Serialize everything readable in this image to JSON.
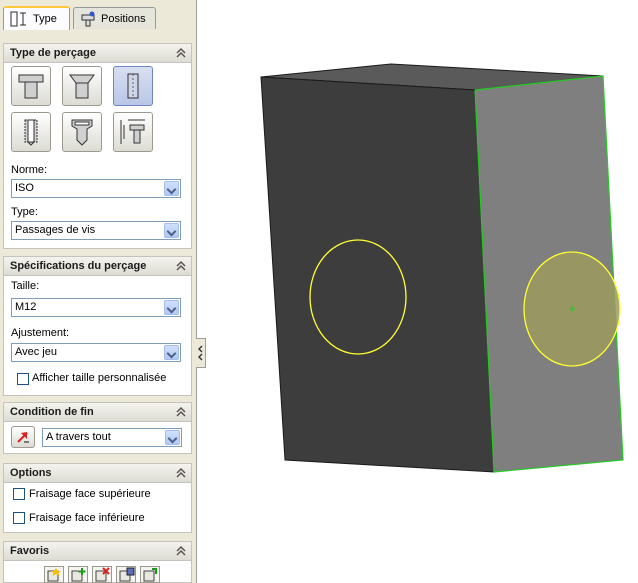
{
  "tabs": [
    {
      "label": "Type",
      "icon": "hole-type-icon",
      "active": true
    },
    {
      "label": "Positions",
      "icon": "hole-position-icon",
      "active": false
    }
  ],
  "hole_type": {
    "title": "Type de perçage",
    "buttons": [
      {
        "icon": "counterbore-icon",
        "selected": false
      },
      {
        "icon": "countersink-icon",
        "selected": false
      },
      {
        "icon": "straight-hole-icon",
        "selected": true
      },
      {
        "icon": "straight-tap-icon",
        "selected": false
      },
      {
        "icon": "tapered-tap-icon",
        "selected": false
      },
      {
        "icon": "legacy-hole-icon",
        "selected": false
      }
    ],
    "standard_label": "Norme:",
    "standard_value": "ISO",
    "type_label": "Type:",
    "type_value": "Passages de vis"
  },
  "hole_spec": {
    "title": "Spécifications du perçage",
    "size_label": "Taille:",
    "size_value": "M12",
    "fit_label": "Ajustement:",
    "fit_value": "Avec jeu",
    "custom_size_label": "Afficher taille personnalisée",
    "custom_size_checked": false
  },
  "end_condition": {
    "title": "Condition de fin",
    "value": "A travers tout"
  },
  "options": {
    "title": "Options",
    "items": [
      {
        "label": "Fraisage face supérieure",
        "checked": false
      },
      {
        "label": "Fraisage face inférieure",
        "checked": false
      }
    ]
  },
  "favorites": {
    "title": "Favoris",
    "icons": [
      "favorite-apply-icon",
      "favorite-add-icon",
      "favorite-delete-icon",
      "favorite-save-icon",
      "favorite-load-icon"
    ]
  },
  "colors": {
    "panel_bg": "#ece9d8",
    "dark_face": "#3d3d3d",
    "light_face": "#7f7f7f",
    "edge_highlight": "#22cc22",
    "hole_preview": "#ffff33"
  }
}
